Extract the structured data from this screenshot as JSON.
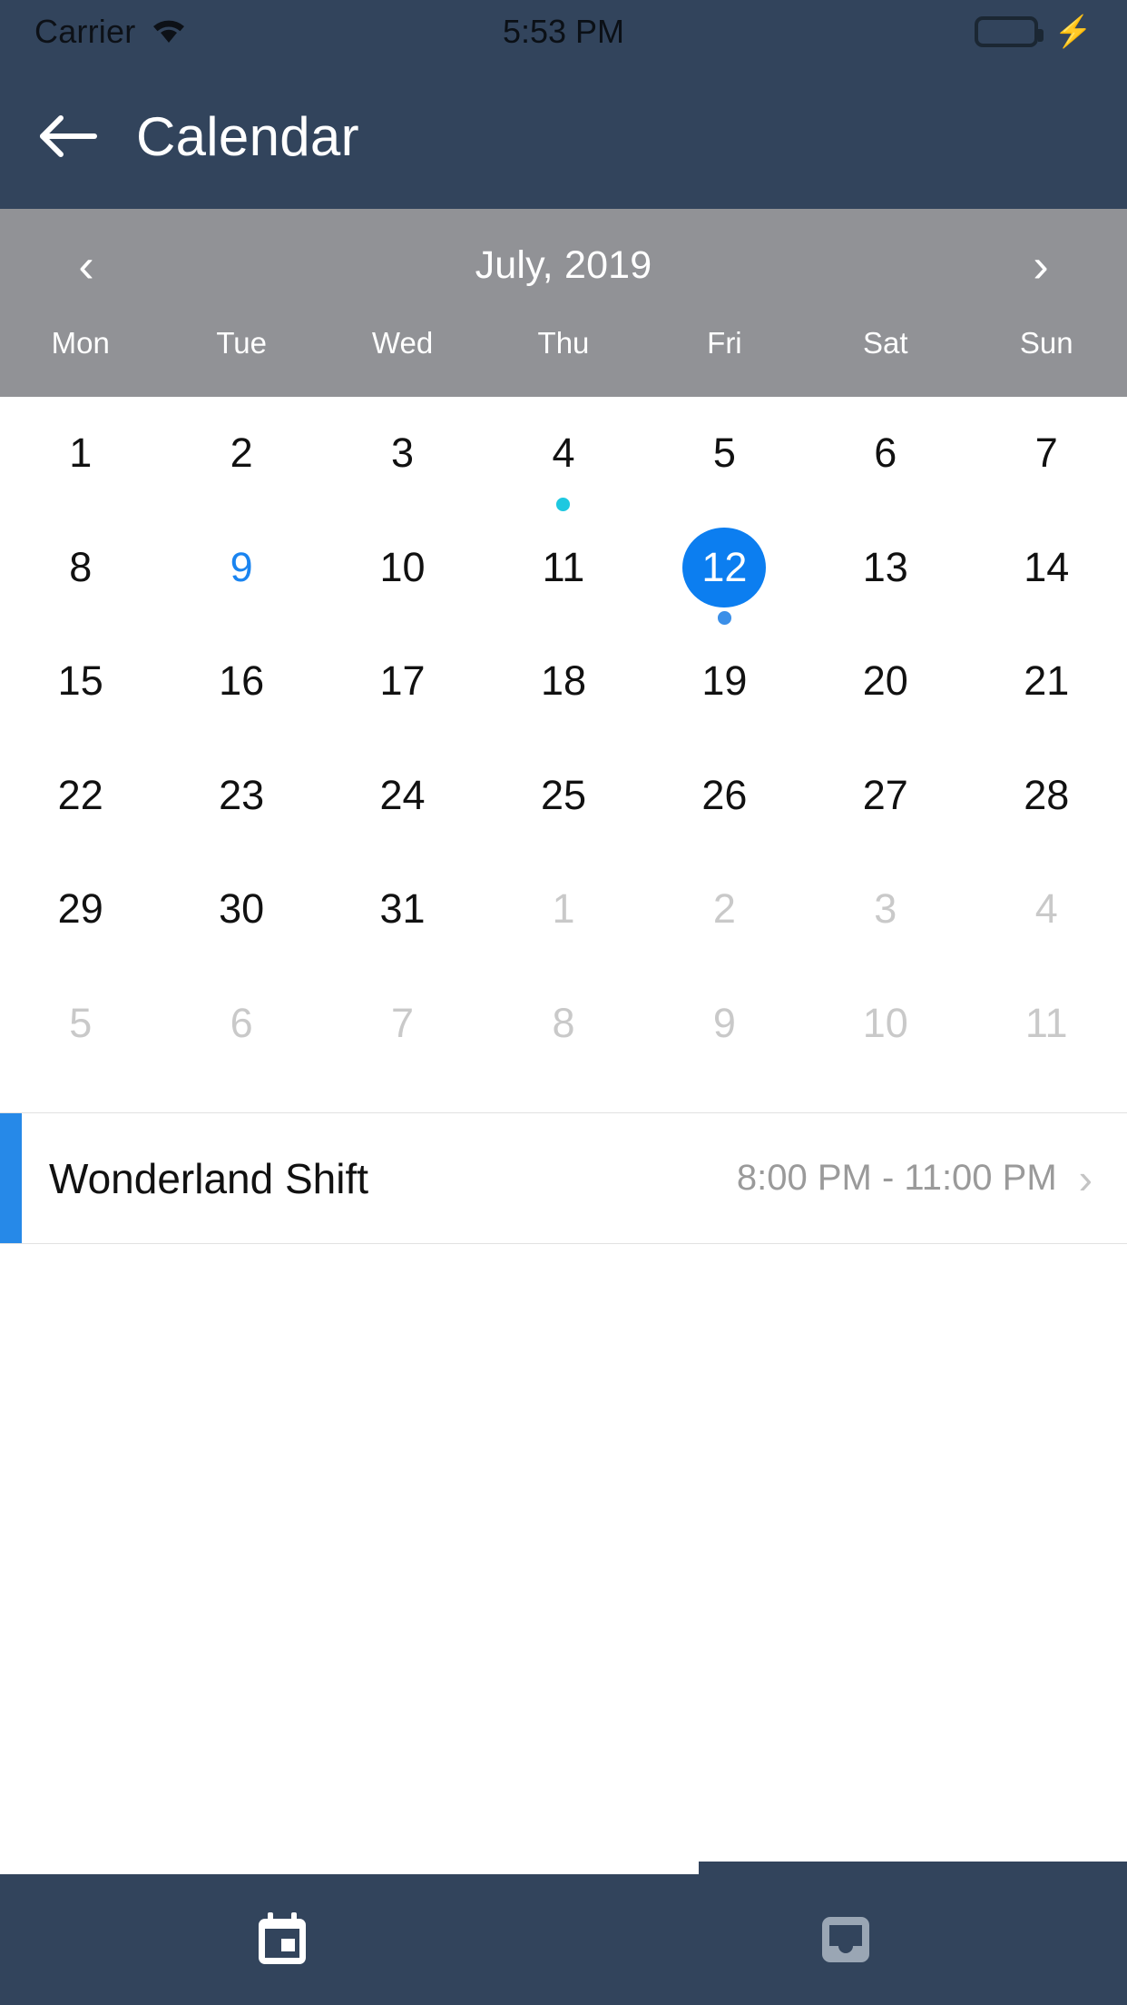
{
  "status_bar": {
    "carrier": "Carrier",
    "time": "5:53 PM",
    "wifi_icon": "wifi-icon",
    "battery_icon": "battery-full-icon",
    "charging_icon": "lightning-bolt-icon",
    "battery_color": "#4cd964",
    "background": "#32445c"
  },
  "nav_bar": {
    "back_icon": "arrow-left-icon",
    "title": "Calendar",
    "background": "#32445c",
    "text_color": "#ffffff"
  },
  "calendar_header": {
    "prev_icon": "chevron-left-icon",
    "next_icon": "chevron-right-icon",
    "month_label": "July, 2019",
    "background": "#919296",
    "weekdays": [
      "Mon",
      "Tue",
      "Wed",
      "Thu",
      "Fri",
      "Sat",
      "Sun"
    ]
  },
  "calendar": {
    "selected_color": "#0c7ef0",
    "today_color": "#1a84f0",
    "outside_color": "#c9c9c9",
    "weeks": [
      [
        {
          "day": "1",
          "state": "current",
          "dot": "none"
        },
        {
          "day": "2",
          "state": "current",
          "dot": "none"
        },
        {
          "day": "3",
          "state": "current",
          "dot": "none"
        },
        {
          "day": "4",
          "state": "current",
          "dot": "cyan"
        },
        {
          "day": "5",
          "state": "current",
          "dot": "none"
        },
        {
          "day": "6",
          "state": "current",
          "dot": "none"
        },
        {
          "day": "7",
          "state": "current",
          "dot": "none"
        }
      ],
      [
        {
          "day": "8",
          "state": "current",
          "dot": "none"
        },
        {
          "day": "9",
          "state": "today",
          "dot": "none"
        },
        {
          "day": "10",
          "state": "current",
          "dot": "none"
        },
        {
          "day": "11",
          "state": "current",
          "dot": "none"
        },
        {
          "day": "12",
          "state": "selected",
          "dot": "blue"
        },
        {
          "day": "13",
          "state": "current",
          "dot": "none"
        },
        {
          "day": "14",
          "state": "current",
          "dot": "none"
        }
      ],
      [
        {
          "day": "15",
          "state": "current",
          "dot": "none"
        },
        {
          "day": "16",
          "state": "current",
          "dot": "none"
        },
        {
          "day": "17",
          "state": "current",
          "dot": "none"
        },
        {
          "day": "18",
          "state": "current",
          "dot": "none"
        },
        {
          "day": "19",
          "state": "current",
          "dot": "none"
        },
        {
          "day": "20",
          "state": "current",
          "dot": "none"
        },
        {
          "day": "21",
          "state": "current",
          "dot": "none"
        }
      ],
      [
        {
          "day": "22",
          "state": "current",
          "dot": "none"
        },
        {
          "day": "23",
          "state": "current",
          "dot": "none"
        },
        {
          "day": "24",
          "state": "current",
          "dot": "none"
        },
        {
          "day": "25",
          "state": "current",
          "dot": "none"
        },
        {
          "day": "26",
          "state": "current",
          "dot": "none"
        },
        {
          "day": "27",
          "state": "current",
          "dot": "none"
        },
        {
          "day": "28",
          "state": "current",
          "dot": "none"
        }
      ],
      [
        {
          "day": "29",
          "state": "current",
          "dot": "none"
        },
        {
          "day": "30",
          "state": "current",
          "dot": "none"
        },
        {
          "day": "31",
          "state": "current",
          "dot": "none"
        },
        {
          "day": "1",
          "state": "outside",
          "dot": "none"
        },
        {
          "day": "2",
          "state": "outside",
          "dot": "none"
        },
        {
          "day": "3",
          "state": "outside",
          "dot": "none"
        },
        {
          "day": "4",
          "state": "outside",
          "dot": "none"
        }
      ],
      [
        {
          "day": "5",
          "state": "outside",
          "dot": "none"
        },
        {
          "day": "6",
          "state": "outside",
          "dot": "none"
        },
        {
          "day": "7",
          "state": "outside",
          "dot": "none"
        },
        {
          "day": "8",
          "state": "outside",
          "dot": "none"
        },
        {
          "day": "9",
          "state": "outside",
          "dot": "none"
        },
        {
          "day": "10",
          "state": "outside",
          "dot": "none"
        },
        {
          "day": "11",
          "state": "outside",
          "dot": "none"
        }
      ]
    ]
  },
  "events": [
    {
      "title": "Wonderland Shift",
      "time": "8:00 PM - 11:00 PM",
      "accent_color": "#2689e8",
      "chevron_icon": "chevron-right-icon"
    }
  ],
  "tab_bar": {
    "background": "#32445c",
    "tabs": [
      {
        "icon": "calendar-icon",
        "active": true,
        "color": "#ffffff"
      },
      {
        "icon": "inbox-icon",
        "active": false,
        "color": "#9aa6b4"
      }
    ]
  }
}
